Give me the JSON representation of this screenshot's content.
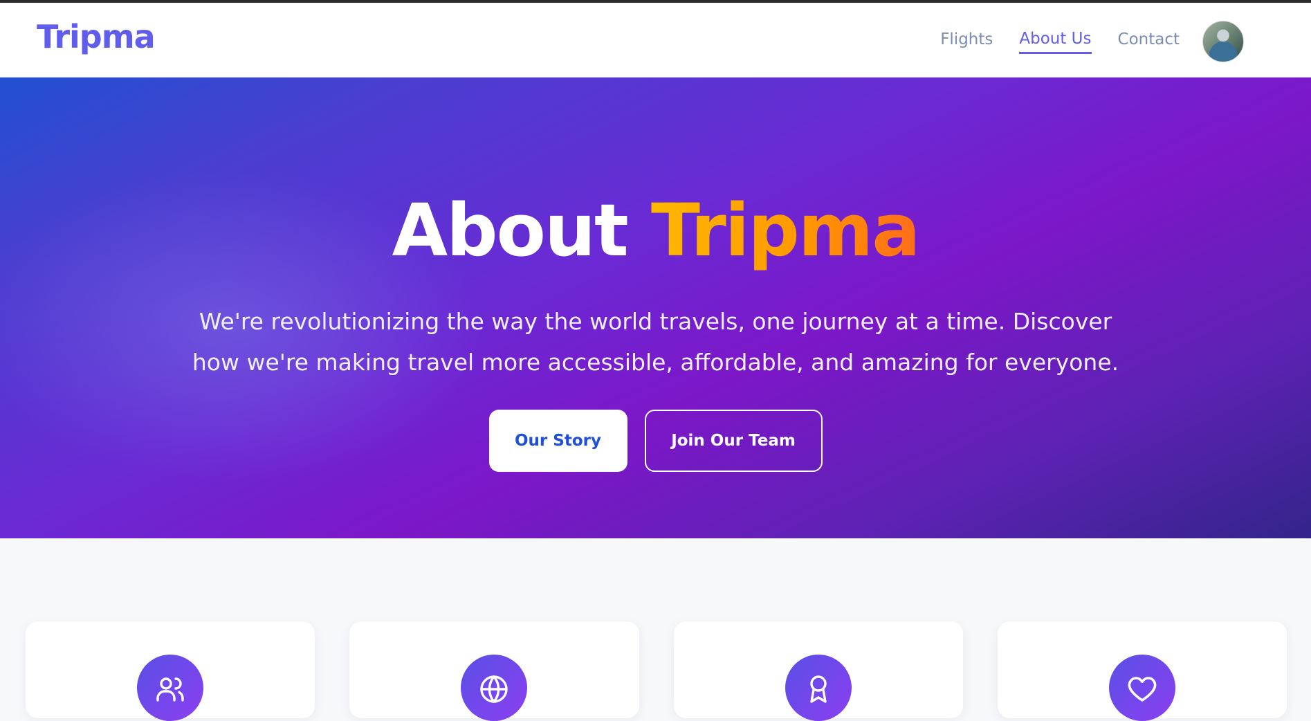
{
  "brand": {
    "logo": "Tripma"
  },
  "nav": {
    "items": [
      {
        "label": "Flights"
      },
      {
        "label": "About Us"
      },
      {
        "label": "Contact"
      }
    ],
    "active": "About Us"
  },
  "hero": {
    "title_prefix": "About",
    "title_accent": "Tripma",
    "subtitle": "We're revolutionizing the way the world travels, one journey at a time. Discover how we're making travel more accessible, affordable, and amazing for everyone.",
    "primary_button": "Our Story",
    "secondary_button": "Join Our Team"
  },
  "cards": [
    {
      "icon": "users-icon"
    },
    {
      "icon": "globe-icon"
    },
    {
      "icon": "award-icon"
    },
    {
      "icon": "heart-icon"
    }
  ],
  "colors": {
    "brand": "#605dec",
    "accent_gradient_start": "#ffb800",
    "accent_gradient_end": "#ff6d1a",
    "primary_button_text": "#1d4fd8"
  }
}
